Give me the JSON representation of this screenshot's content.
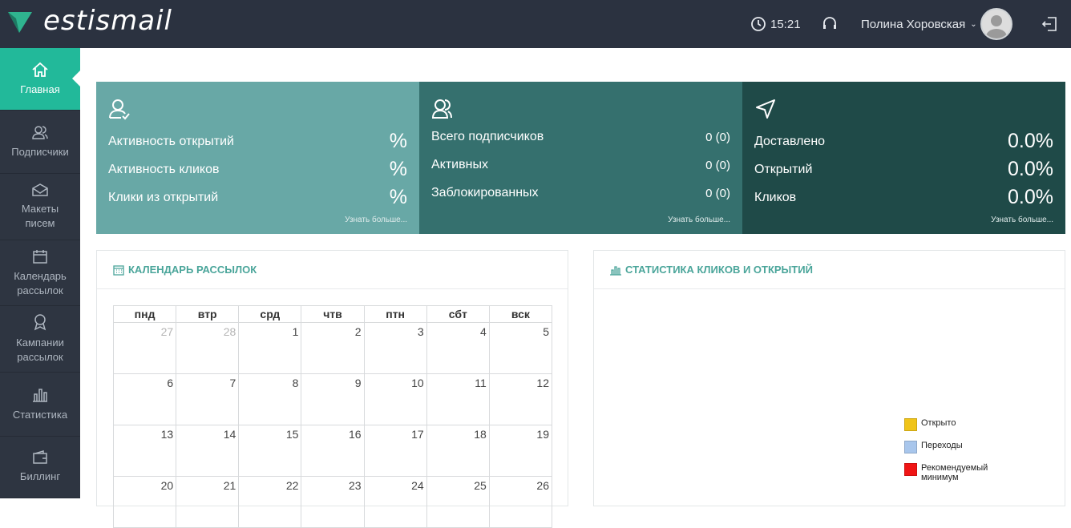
{
  "header": {
    "brand": "estismail",
    "time": "15:21",
    "user": "Полина Хоровская"
  },
  "sidebar": {
    "items": [
      {
        "label": "Главная",
        "icon": "home-icon",
        "active": true
      },
      {
        "label": "Подписчики",
        "icon": "users-icon"
      },
      {
        "label": "Макеты писем",
        "icon": "envelope-icon"
      },
      {
        "label": "Календарь рассылок",
        "icon": "calendar-icon"
      },
      {
        "label": "Кампании рассылок",
        "icon": "award-icon"
      },
      {
        "label": "Статистика",
        "icon": "bar-chart-icon"
      },
      {
        "label": "Биллинг",
        "icon": "wallet-icon"
      }
    ]
  },
  "stats": [
    {
      "color": "#68a8a6",
      "rows": [
        {
          "label": "Активность открытий",
          "value": "%"
        },
        {
          "label": "Активность кликов",
          "value": "%"
        },
        {
          "label": "Клики из открытий",
          "value": "%"
        }
      ],
      "more": "Узнать больше..."
    },
    {
      "color": "#35706e",
      "rows": [
        {
          "label": "Всего подписчиков",
          "value": "0 (0)"
        },
        {
          "label": "Активных",
          "value": "0 (0)"
        },
        {
          "label": "Заблокированных",
          "value": "0 (0)"
        }
      ],
      "more": "Узнать больше..."
    },
    {
      "color": "#1f4a48",
      "rows": [
        {
          "label": "Доставлено",
          "value": "0.0%"
        },
        {
          "label": "Открытий",
          "value": "0.0%"
        },
        {
          "label": "Кликов",
          "value": "0.0%"
        }
      ],
      "more": "Узнать больше..."
    }
  ],
  "calendar": {
    "title": "КАЛЕНДАРЬ РАССЫЛОК",
    "days": [
      "пнд",
      "втр",
      "срд",
      "чтв",
      "птн",
      "сбт",
      "вск"
    ],
    "weeks": [
      [
        "27",
        "28",
        "1",
        "2",
        "3",
        "4",
        "5"
      ],
      [
        "6",
        "7",
        "8",
        "9",
        "10",
        "11",
        "12"
      ],
      [
        "13",
        "14",
        "15",
        "16",
        "17",
        "18",
        "19"
      ],
      [
        "20",
        "21",
        "22",
        "23",
        "24",
        "25",
        "26"
      ]
    ]
  },
  "chart": {
    "title": "СТАТИСТИКА КЛИКОВ И ОТКРЫТИЙ",
    "legend": [
      {
        "label": "Открыто",
        "color": "#f0c419"
      },
      {
        "label": "Переходы",
        "color": "#a8c6ec"
      },
      {
        "label": "Рекомендуемый минимум",
        "color": "#f01515"
      }
    ]
  }
}
